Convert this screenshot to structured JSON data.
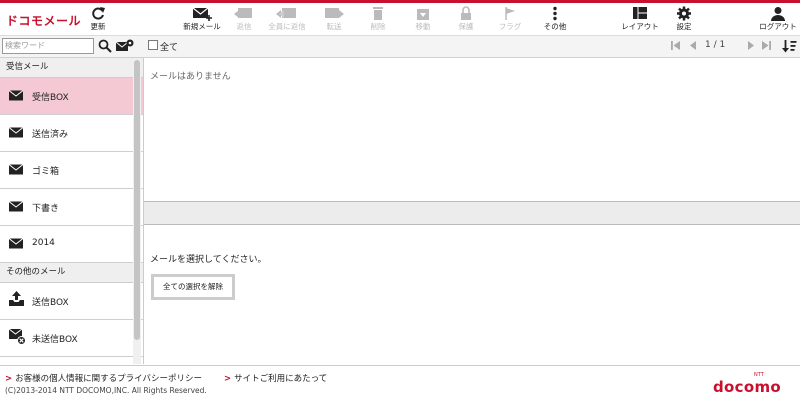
{
  "header": {
    "logo": "ドコモメール",
    "refresh_label": "更新",
    "toolbar": [
      {
        "id": "new",
        "label": "新規メール",
        "enabled": true,
        "icon": "compose-icon"
      },
      {
        "id": "reply",
        "label": "返信",
        "enabled": false,
        "icon": "reply-icon"
      },
      {
        "id": "replyall",
        "label": "全員に返信",
        "enabled": false,
        "icon": "reply-all-icon"
      },
      {
        "id": "forward",
        "label": "転送",
        "enabled": false,
        "icon": "forward-icon"
      },
      {
        "id": "delete",
        "label": "削除",
        "enabled": false,
        "icon": "trash-icon"
      },
      {
        "id": "move",
        "label": "移動",
        "enabled": false,
        "icon": "move-icon"
      },
      {
        "id": "protect",
        "label": "保護",
        "enabled": false,
        "icon": "lock-icon"
      },
      {
        "id": "flag",
        "label": "フラグ",
        "enabled": false,
        "icon": "flag-icon"
      },
      {
        "id": "other",
        "label": "その他",
        "enabled": true,
        "icon": "more-icon"
      }
    ],
    "layout_label": "レイアウト",
    "settings_label": "設定",
    "logout_label": "ログアウト"
  },
  "search": {
    "placeholder": "検索ワード"
  },
  "list_toolbar": {
    "select_all_label": "全て",
    "page": "1 / 1"
  },
  "sidebar": {
    "received_header": "受信メール",
    "received": [
      {
        "label": "受信BOX",
        "active": true
      },
      {
        "label": "送信済み",
        "active": false
      },
      {
        "label": "ゴミ箱",
        "active": false
      },
      {
        "label": "下書き",
        "active": false
      },
      {
        "label": "2014",
        "active": false
      }
    ],
    "other_header": "その他のメール",
    "other": [
      {
        "label": "送信BOX"
      },
      {
        "label": "未送信BOX"
      }
    ]
  },
  "main": {
    "empty_message": "メールはありません",
    "select_prompt": "メールを選択してください。",
    "clear_selection_label": "全ての選択を解除"
  },
  "footer": {
    "privacy_link": "お客様の個人情報に関するプライバシーポリシー",
    "terms_link": "サイトご利用にあたって",
    "copyright": "(C)2013-2014 NTT DOCOMO,INC. All Rights Reserved.",
    "brand": "docomo",
    "brand_sub": "NTT"
  },
  "colors": {
    "brand": "#c8102e",
    "active_item": "#f4c9d4",
    "disabled": "#bbbbbb"
  }
}
